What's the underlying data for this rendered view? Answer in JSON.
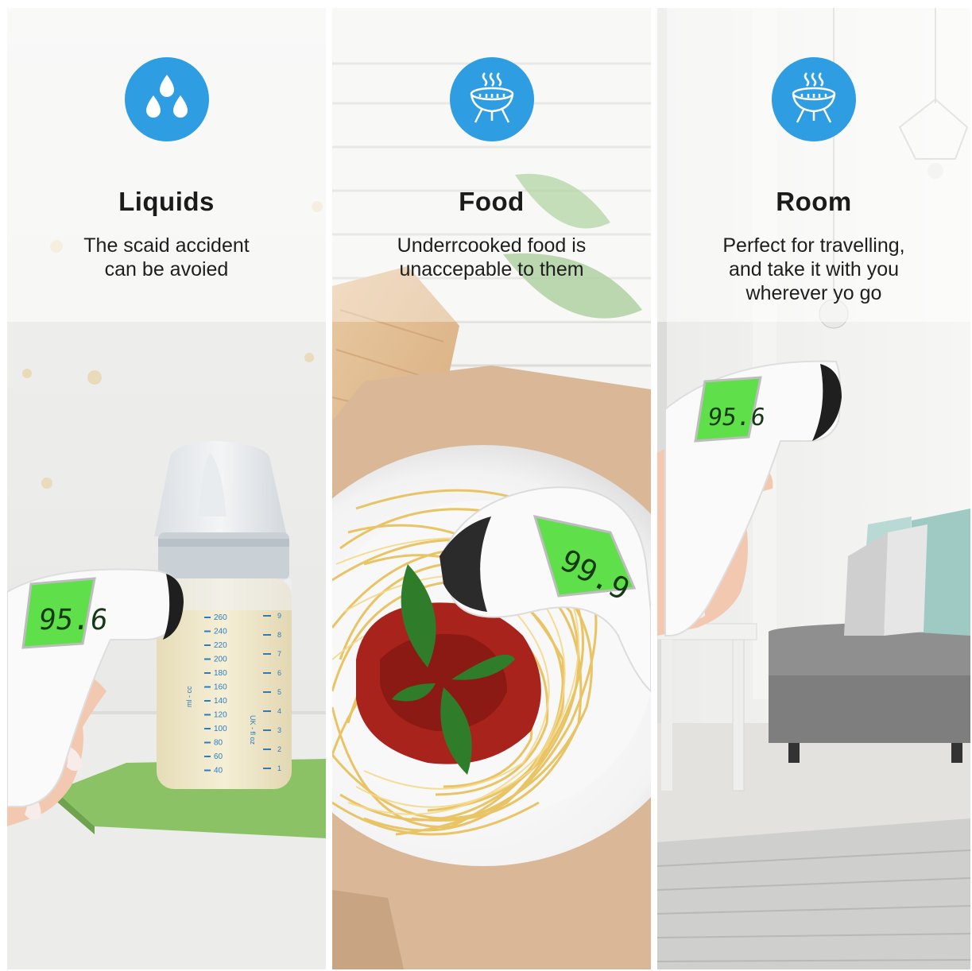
{
  "panels": [
    {
      "icon": "water-drops-icon",
      "title": "Liquids",
      "desc_lines": [
        "The scaid accident",
        "can be avoied"
      ],
      "reading": "95.6",
      "bottle_ml": [
        "260",
        "240",
        "220",
        "200",
        "180",
        "160",
        "140",
        "120",
        "100",
        "80",
        "60",
        "40"
      ],
      "bottle_ml_label": "ml - cc",
      "bottle_oz_label": "UK - fl oz",
      "bottle_oz": [
        "9",
        "8",
        "7",
        "6",
        "5",
        "4",
        "3",
        "2",
        "1"
      ]
    },
    {
      "icon": "grill-icon",
      "title": "Food",
      "desc_lines": [
        "Underrcooked food is",
        "unaccepable to them"
      ],
      "reading": "99.9"
    },
    {
      "icon": "grill-icon",
      "title": "Room",
      "desc_lines": [
        "Perfect for travelling,",
        "and take it with you",
        "wherever yo go"
      ],
      "reading": "95.6"
    }
  ],
  "colors": {
    "icon_bg": "#2f9de2",
    "lcd_green": "#5fe04a",
    "sauce": "#a8231c",
    "basil": "#2f7d2a",
    "pasta": "#f0cf6e"
  }
}
